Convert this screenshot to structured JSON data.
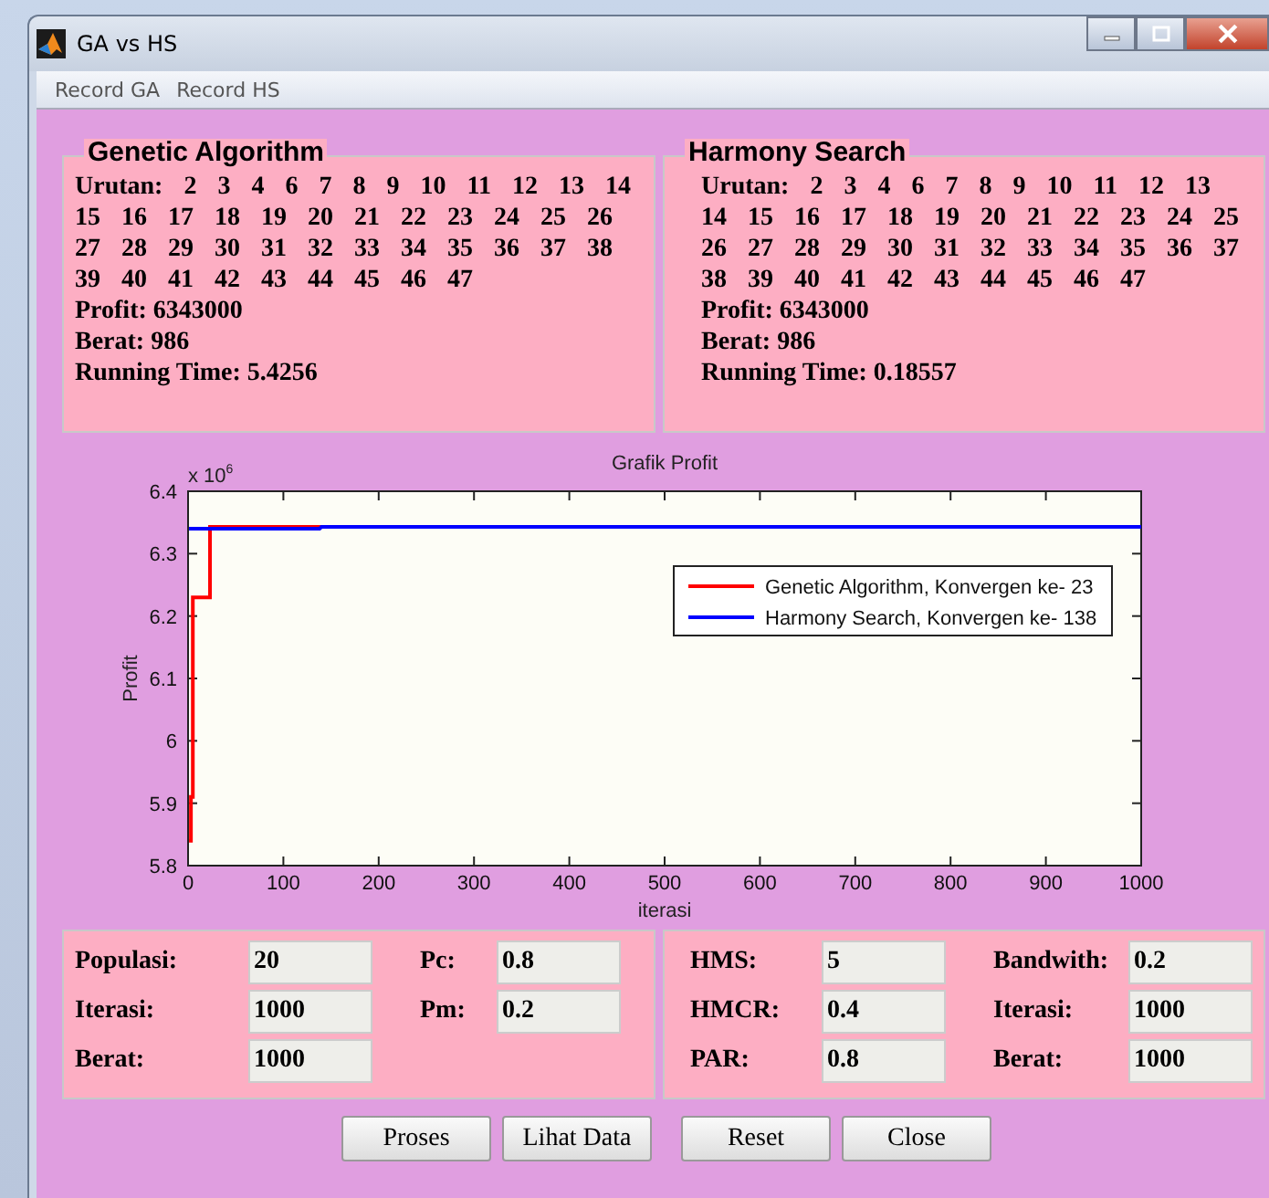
{
  "window": {
    "title": "GA vs HS"
  },
  "menu": [
    "Record GA",
    "Record HS"
  ],
  "results": [
    {
      "title": "Genetic Algorithm",
      "urutan": "Urutan: 2 3 4 6 7 8 9 10 11 12 13 14 15 16 17 18 19 20 21 22 23 24 25 26 27 28 29 30 31 32 33 34 35 36 37 38 39 40 41 42 43 44 45 46 47",
      "profit": "Profit: 6343000",
      "berat": "Berat: 986",
      "time": "Running Time: 5.4256"
    },
    {
      "title": "Harmony Search",
      "urutan": "Urutan: 2 3 4 6 7 8 9 10 11 12 13 14 15 16 17 18 19 20 21 22 23 24 25 26 27 28 29 30 31 32 33 34 35 36 37 38 39 40 41 42 43 44 45 46 47",
      "profit": "Profit: 6343000",
      "berat": "Berat: 986",
      "time": "Running Time: 0.18557"
    }
  ],
  "chart": {
    "exponent": "x 10",
    "exponent_power": "6",
    "chart_data": {
      "type": "line",
      "title": "Grafik Profit",
      "xlabel": "iterasi",
      "ylabel": "Profit",
      "x": [
        1,
        3,
        3,
        5,
        5,
        23,
        23,
        138,
        140,
        1000
      ],
      "series": [
        {
          "name": "Genetic Algorithm, Konvergen ke- 23",
          "color": "#ff0000",
          "values": [
            5.84,
            5.84,
            5.91,
            5.91,
            6.23,
            6.23,
            6.343,
            6.343,
            6.343,
            null
          ]
        },
        {
          "name": "Harmony Search, Konvergen ke- 138",
          "color": "#0000ff",
          "values": [
            6.34,
            6.34,
            6.34,
            6.34,
            6.34,
            6.34,
            6.34,
            6.34,
            6.343,
            6.343
          ]
        }
      ],
      "legend": true,
      "xlim": [
        0,
        1000
      ],
      "ylim": [
        5.8,
        6.4
      ],
      "xticks": [
        0,
        100,
        200,
        300,
        400,
        500,
        600,
        700,
        800,
        900,
        1000
      ],
      "yticks": [
        5.8,
        5.9,
        6,
        6.1,
        6.2,
        6.3,
        6.4
      ]
    }
  },
  "params": [
    {
      "columns": [
        [
          {
            "label": "Populasi:",
            "value": "20"
          },
          {
            "label": "Iterasi:",
            "value": "1000"
          },
          {
            "label": "Berat:",
            "value": "1000"
          }
        ],
        [
          {
            "label": "Pc:",
            "value": "0.8"
          },
          {
            "label": "Pm:",
            "value": "0.2"
          }
        ]
      ]
    },
    {
      "columns": [
        [
          {
            "label": "HMS:",
            "value": "5"
          },
          {
            "label": "HMCR:",
            "value": "0.4"
          },
          {
            "label": "PAR:",
            "value": "0.8"
          }
        ],
        [
          {
            "label": "Bandwith:",
            "value": "0.2"
          },
          {
            "label": "Iterasi:",
            "value": "1000"
          },
          {
            "label": "Berat:",
            "value": "1000"
          }
        ]
      ]
    }
  ],
  "buttons": [
    "Proses",
    "Lihat Data",
    "Reset",
    "Close"
  ]
}
